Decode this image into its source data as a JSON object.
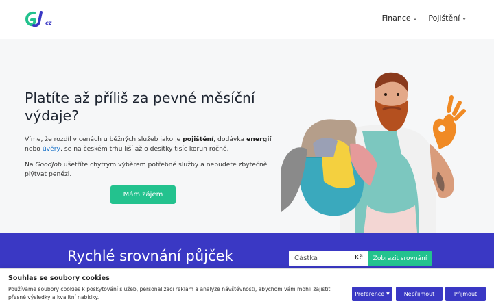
{
  "header": {
    "logo_text": "GJ.cz",
    "nav": [
      {
        "label": "Finance"
      },
      {
        "label": "Pojištění"
      }
    ]
  },
  "hero": {
    "title": "Platíte až příliš za pevné měsíční výdaje?",
    "p1_a": "Víme, že rozdíl v cenách u běžných služeb jako je ",
    "p1_b": "pojištění",
    "p1_c": ", dodávka ",
    "p1_d": "energií",
    "p1_e": " nebo ",
    "p1_f": "úvěry",
    "p1_g": ", se na českém trhu liší až o desítky tisíc korun ročně.",
    "p2_a": "Na ",
    "p2_b": "GoodJob",
    "p2_c": " ušetříte chytrým výběrem potřebné služby a nebudete zbytečně plýtvat penězi.",
    "cta_label": "Mám zájem"
  },
  "compare": {
    "title": "Rychlé srovnání půjček",
    "amount_placeholder": "Částka",
    "currency": "Kč",
    "button_label": "Zobrazit srovnání"
  },
  "cookie": {
    "title": "Souhlas se soubory cookies",
    "text": "Používáme soubory cookies k poskytování služeb, personalizaci reklam a analýze návštěvnosti, abychom vám mohli zajistit přesné výsledky a kvalitní nabídky.",
    "preferences_label": "Preference",
    "reject_label": "Nepřijmout",
    "accept_label": "Přijmout"
  },
  "colors": {
    "brand_green": "#23c28e",
    "brand_blue": "#3a38c4",
    "link_blue": "#1a73c9"
  }
}
